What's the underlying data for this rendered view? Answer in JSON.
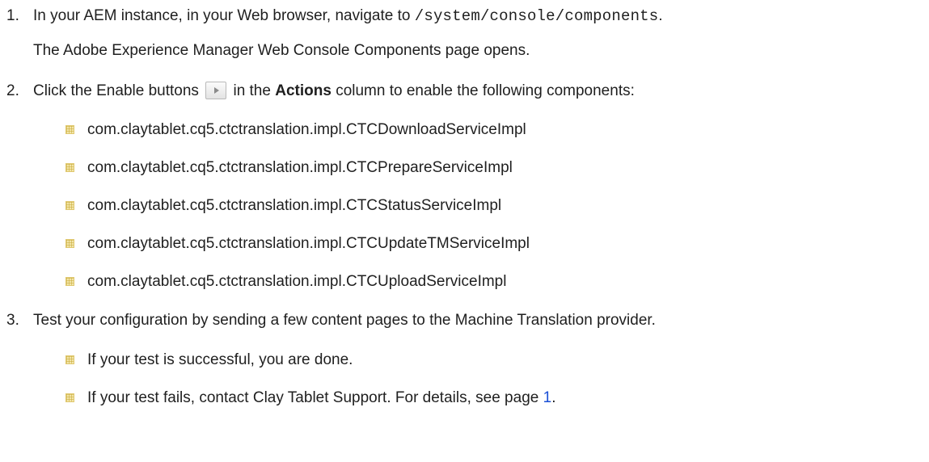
{
  "steps": [
    {
      "number": "1.",
      "text_before": "In your AEM instance, in your Web browser, navigate to ",
      "code": "/system/console/components",
      "text_after": ".",
      "note": "The Adobe Experience Manager Web Console Components page opens."
    },
    {
      "number": "2.",
      "text_before": "Click the Enable buttons ",
      "button_icon": "play-icon",
      "text_middle": " in the ",
      "bold": "Actions",
      "text_after": " column to enable the following components:",
      "items": [
        "com.claytablet.cq5.ctctranslation.impl.CTCDownloadServiceImpl",
        "com.claytablet.cq5.ctctranslation.impl.CTCPrepareServiceImpl",
        "com.claytablet.cq5.ctctranslation.impl.CTCStatusServiceImpl",
        "com.claytablet.cq5.ctctranslation.impl.CTCUpdateTMServiceImpl",
        "com.claytablet.cq5.ctctranslation.impl.CTCUploadServiceImpl"
      ]
    },
    {
      "number": "3.",
      "text": "Test your configuration by sending a few content pages to the Machine Translation provider.",
      "items": [
        {
          "text": "If your test is successful, you are done."
        },
        {
          "text_before": "If your test fails, contact Clay Tablet Support. For details, see page ",
          "link": "1",
          "text_after": "."
        }
      ]
    }
  ],
  "colors": {
    "link": "#1a4fd6",
    "text": "#1f1f1f",
    "bullet": "#f3e6a8"
  }
}
